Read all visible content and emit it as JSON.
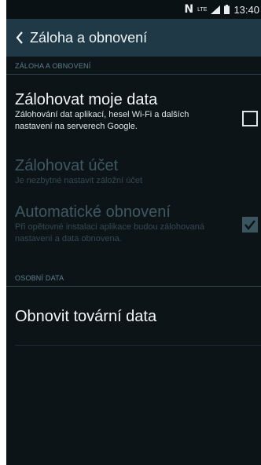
{
  "status_bar": {
    "time": "13:40",
    "network": "LTE",
    "icons": [
      "nfc-icon",
      "lte-icon",
      "signal-icon",
      "battery-icon"
    ]
  },
  "action_bar": {
    "title": "Záloha a obnovení",
    "back_icon": "chevron-left-icon"
  },
  "sections": [
    {
      "header": "ZÁLOHA A OBNOVENÍ",
      "items": [
        {
          "title": "Zálohovat moje data",
          "summary": "Zálohování dat aplikací, hesel Wi-Fi a dalších nastavení na serverech Google.",
          "enabled": true,
          "checked": false
        },
        {
          "title": "Zálohovat účet",
          "summary": "Je nezbytné nastavit záložní účet",
          "enabled": false
        },
        {
          "title": "Automatické obnovení",
          "summary": "Při opětovné instalaci aplikace budou zálohovaná nastavení a data obnovena.",
          "enabled": false,
          "checked": true
        }
      ]
    },
    {
      "header": "OSOBNÍ DATA",
      "items": [
        {
          "title": "Obnovit tovární data",
          "enabled": true
        }
      ]
    }
  ],
  "colors": {
    "background": "#0c1418",
    "action_bar": "#1f3947",
    "section_header": "#5d7f8f",
    "disabled_text": "#3f5862"
  }
}
